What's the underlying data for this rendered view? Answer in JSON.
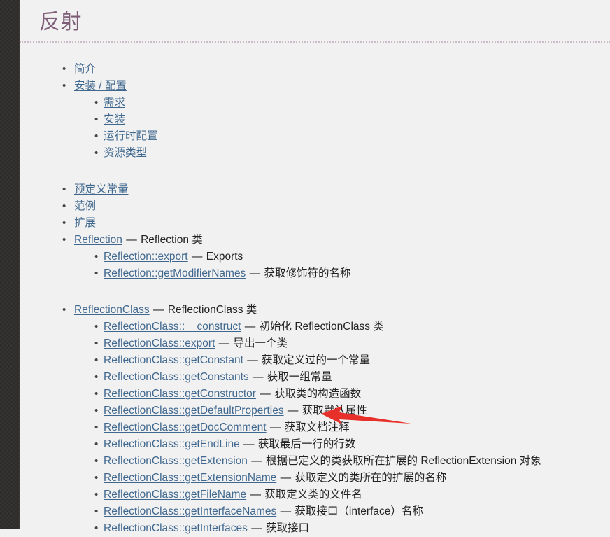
{
  "page": {
    "title": "反射",
    "background_color": "#f1f1f1",
    "title_color": "#7d5d78",
    "link_color": "#40688f",
    "gutter_color": "#2e2c2b"
  },
  "toc": {
    "groups": [
      {
        "items": [
          {
            "link": "简介",
            "dash": "",
            "desc": ""
          },
          {
            "link": "安装 / 配置",
            "dash": "",
            "desc": "",
            "children": [
              {
                "link": "需求",
                "dash": "",
                "desc": ""
              },
              {
                "link": "安装",
                "dash": "",
                "desc": ""
              },
              {
                "link": "运行时配置",
                "dash": "",
                "desc": ""
              },
              {
                "link": "资源类型",
                "dash": "",
                "desc": ""
              }
            ]
          }
        ]
      },
      {
        "items": [
          {
            "link": "预定义常量",
            "dash": "",
            "desc": ""
          },
          {
            "link": "范例",
            "dash": "",
            "desc": ""
          },
          {
            "link": "扩展",
            "dash": "",
            "desc": ""
          },
          {
            "link": "Reflection",
            "dash": "—",
            "desc": "Reflection 类",
            "children": [
              {
                "link": "Reflection::export",
                "dash": "—",
                "desc": "Exports"
              },
              {
                "link": "Reflection::getModifierNames",
                "dash": "—",
                "desc": "获取修饰符的名称"
              }
            ]
          }
        ]
      },
      {
        "items": [
          {
            "link": "ReflectionClass",
            "dash": "—",
            "desc": "ReflectionClass 类",
            "children": [
              {
                "link": "ReflectionClass::__construct",
                "dash": "—",
                "desc": "初始化 ReflectionClass 类"
              },
              {
                "link": "ReflectionClass::export",
                "dash": "—",
                "desc": "导出一个类"
              },
              {
                "link": "ReflectionClass::getConstant",
                "dash": "—",
                "desc": "获取定义过的一个常量"
              },
              {
                "link": "ReflectionClass::getConstants",
                "dash": "—",
                "desc": "获取一组常量"
              },
              {
                "link": "ReflectionClass::getConstructor",
                "dash": "—",
                "desc": "获取类的构造函数"
              },
              {
                "link": "ReflectionClass::getDefaultProperties",
                "dash": "—",
                "desc": "获取默认属性"
              },
              {
                "link": "ReflectionClass::getDocComment",
                "dash": "—",
                "desc": "获取文档注释"
              },
              {
                "link": "ReflectionClass::getEndLine",
                "dash": "—",
                "desc": "获取最后一行的行数"
              },
              {
                "link": "ReflectionClass::getExtension",
                "dash": "—",
                "desc": "根据已定义的类获取所在扩展的 ReflectionExtension 对象"
              },
              {
                "link": "ReflectionClass::getExtensionName",
                "dash": "—",
                "desc": "获取定义的类所在的扩展的名称"
              },
              {
                "link": "ReflectionClass::getFileName",
                "dash": "—",
                "desc": "获取定义类的文件名"
              },
              {
                "link": "ReflectionClass::getInterfaceNames",
                "dash": "—",
                "desc": "获取接口（interface）名称"
              },
              {
                "link": "ReflectionClass::getInterfaces",
                "dash": "—",
                "desc": "获取接口"
              }
            ]
          }
        ]
      }
    ]
  },
  "annotation": {
    "arrow_color": "#e8302a",
    "points_at": "ReflectionClass::getDocComment",
    "direction": "left"
  },
  "icons": {
    "bullet_glyph": "•"
  }
}
